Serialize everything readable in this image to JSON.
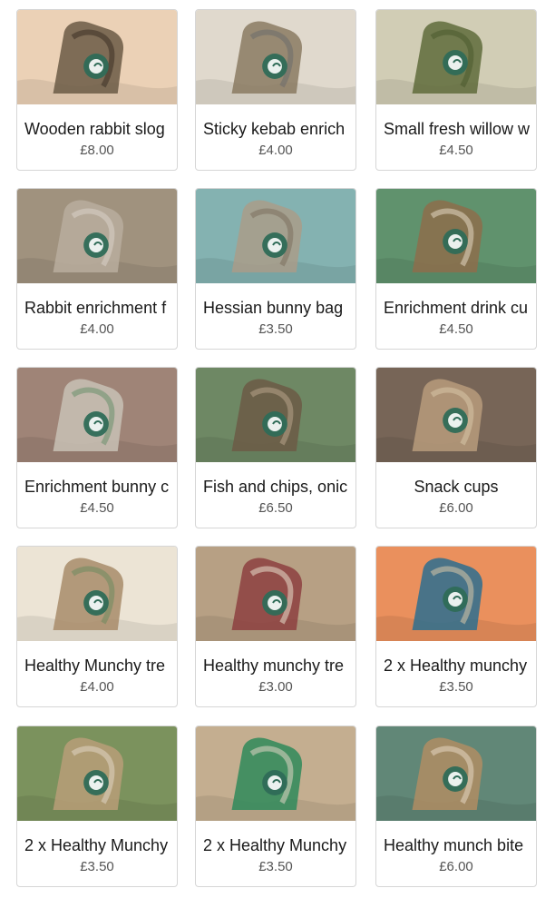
{
  "products": [
    {
      "title": "Wooden rabbit slog",
      "price": "£8.00",
      "image": "wooden-rabbit-slogan-image",
      "colors": [
        "#6b5a45",
        "#e7c7a6",
        "#3b2f25"
      ]
    },
    {
      "title": "Sticky kebab enrich",
      "price": "£4.00",
      "image": "sticky-kebab-enrichment-image",
      "colors": [
        "#8a7a62",
        "#d9d1c2",
        "#6b6b6b"
      ]
    },
    {
      "title": "Small fresh willow w",
      "price": "£4.50",
      "image": "willow-wreath-image",
      "colors": [
        "#5f6b3b",
        "#c7c2a5",
        "#4b5a2d"
      ]
    },
    {
      "title": "Rabbit enrichment f",
      "price": "£4.00",
      "image": "rabbit-enrichment-bag-image",
      "colors": [
        "#b8ad9d",
        "#8c7a62",
        "#d8d2c8"
      ]
    },
    {
      "title": "Hessian bunny bag",
      "price": "£3.50",
      "image": "hessian-bunny-bag-image",
      "colors": [
        "#a99c89",
        "#6aa1a0",
        "#7b6f5f"
      ]
    },
    {
      "title": "Enrichment drink cu",
      "price": "£4.50",
      "image": "enrichment-drink-cup-image",
      "colors": [
        "#8d6d4b",
        "#3e7b4d",
        "#e4d7c2"
      ]
    },
    {
      "title": "Enrichment bunny c",
      "price": "£4.50",
      "image": "enrichment-bunny-cone-image",
      "colors": [
        "#c8c1b5",
        "#8a6a5a",
        "#6a8f6b"
      ]
    },
    {
      "title": "Fish  and chips, onic",
      "price": "£6.50",
      "image": "fish-and-chips-image",
      "colors": [
        "#6c5a45",
        "#4f6e43",
        "#b8a48a"
      ]
    },
    {
      "title": "Snack cups",
      "price": "£6.00",
      "image": "snack-cups-image",
      "colors": [
        "#b79b7b",
        "#5a4433",
        "#d9c7a8"
      ]
    },
    {
      "title": "Healthy Munchy tre",
      "price": "£4.00",
      "image": "healthy-munchy-treat-image",
      "colors": [
        "#a88c6a",
        "#e8dfcc",
        "#6e8a5f"
      ]
    },
    {
      "title": "Healthy munchy tre",
      "price": "£3.00",
      "image": "healthy-munchy-treat-2-image",
      "colors": [
        "#8d3f3f",
        "#a88c6a",
        "#e8dfcc"
      ]
    },
    {
      "title": "2 x Healthy munchy",
      "price": "£3.50",
      "image": "healthy-munchy-parcels-image",
      "colors": [
        "#2d6f8f",
        "#e6783a",
        "#d9c7a8"
      ]
    },
    {
      "title": "2 x Healthy Munchy",
      "price": "£3.50",
      "image": "healthy-munchy-hay-image",
      "colors": [
        "#b89d78",
        "#5f7a3a",
        "#e0d6c4"
      ]
    },
    {
      "title": "2 x Healthy Munchy",
      "price": "£3.50",
      "image": "healthy-munchy-fresh-apple-image",
      "colors": [
        "#2f8a5a",
        "#b89d78",
        "#e0d6c4"
      ]
    },
    {
      "title": "Healthy munch bite",
      "price": "£6.00",
      "image": "healthy-munch-bite-box-image",
      "colors": [
        "#b08d63",
        "#3f6d5a",
        "#e6d7c2"
      ]
    }
  ]
}
